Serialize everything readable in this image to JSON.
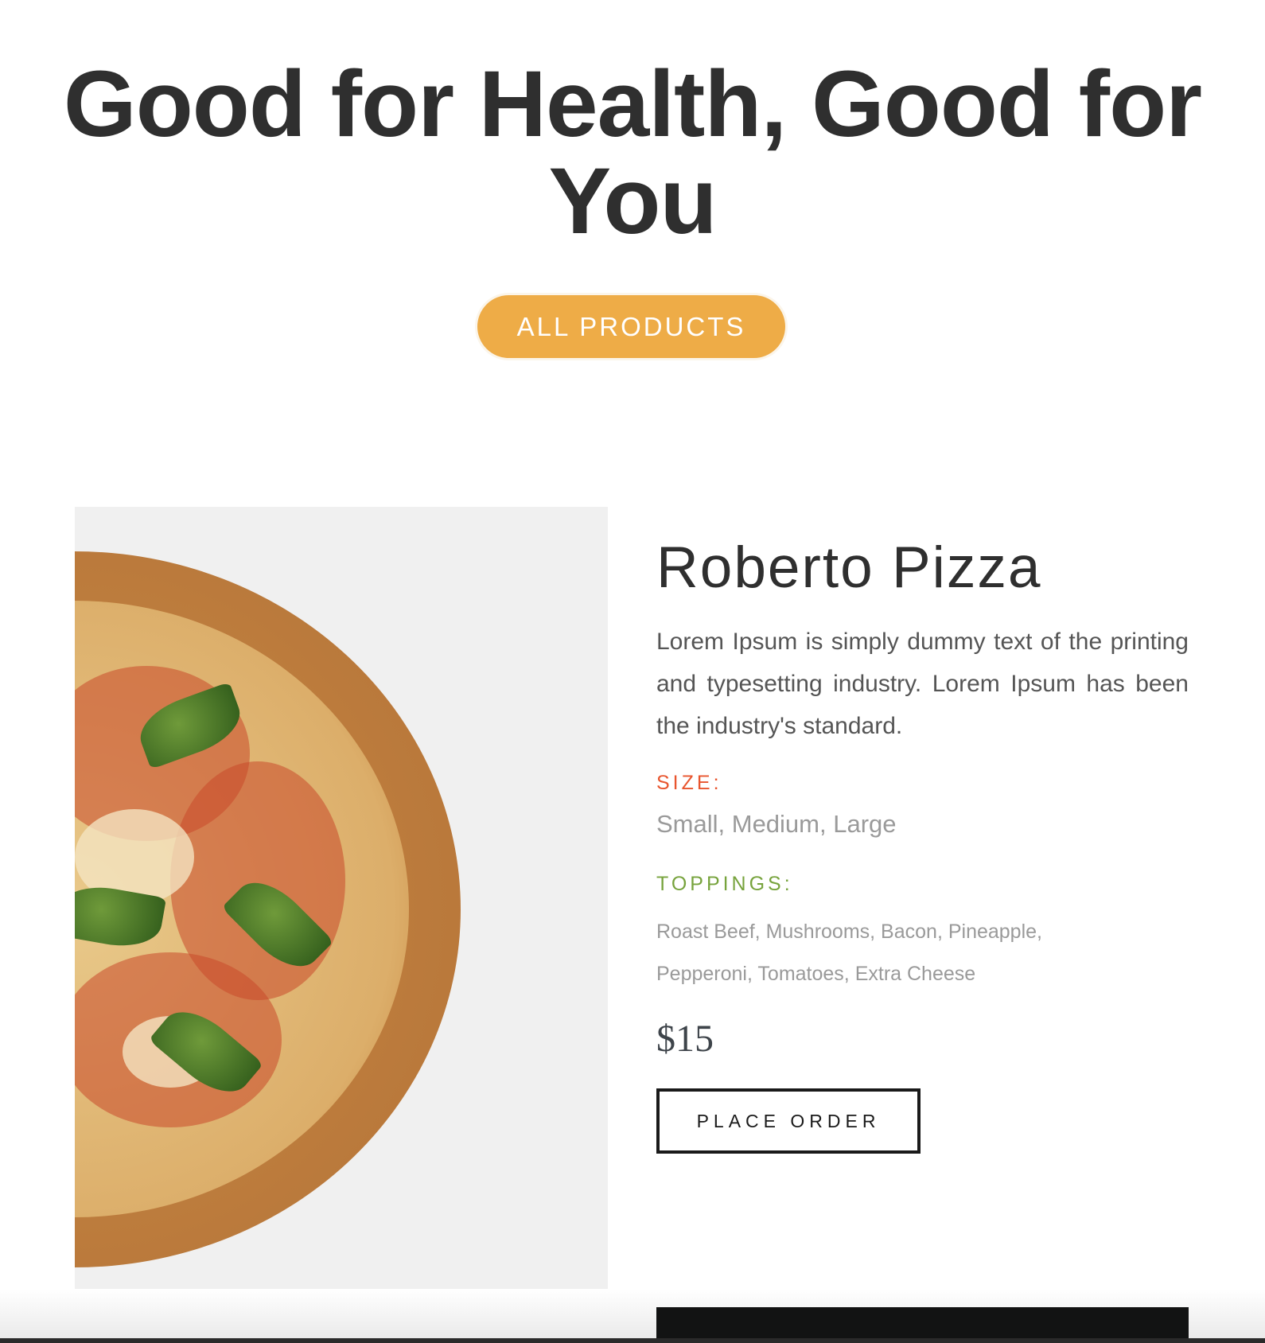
{
  "hero": {
    "line1": "Good for Health, Good for",
    "line2": "You"
  },
  "all_products_label": "ALL PRODUCTS",
  "product": {
    "name": "Roberto Pizza",
    "description": "Lorem Ipsum is simply dummy text of the printing and typesetting industry. Lorem Ipsum has been the industry's standard.",
    "size_label": "SIZE:",
    "sizes": "Small, Medium, Large",
    "toppings_label": "TOPPINGS:",
    "toppings_line1": "Roast Beef, Mushrooms, Bacon, Pineapple,",
    "toppings_line2": "Pepperoni, Tomatoes, Extra Cheese",
    "price": "$15",
    "order_label": "PLACE ORDER"
  },
  "colors": {
    "accent": "#eeac47",
    "size": "#e8552e",
    "toppings": "#77a33d"
  }
}
